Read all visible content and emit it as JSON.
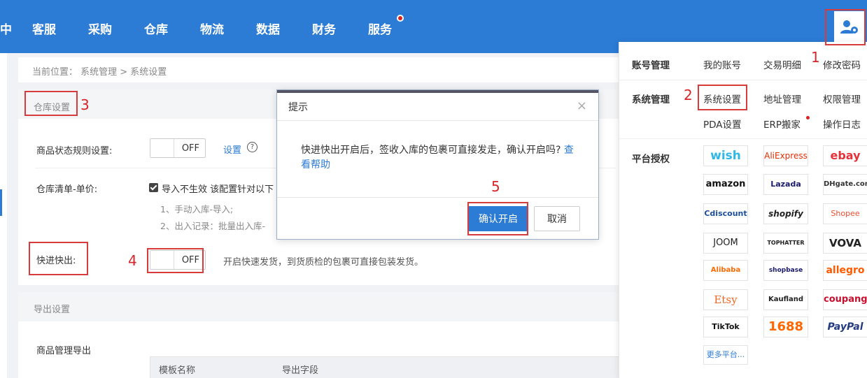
{
  "nav": {
    "items": [
      "客服",
      "采购",
      "仓库",
      "物流",
      "数据",
      "财务",
      "服务"
    ]
  },
  "breadcrumb": "当前位置：  系统管理 > 系统设置",
  "warehouse": {
    "title": "仓库设置",
    "status_rule_label": "商品状态规则设置:",
    "status_rule_toggle": "OFF",
    "status_rule_link": "设置",
    "help_icon": "?",
    "price_label": "仓库清单-单价:",
    "price_check_text": "导入不生效 该配置针对以下",
    "price_line1": "1、手动入库-导入;",
    "price_line2": "2、出入记录：批量出入库-",
    "fast_label": "快进快出:",
    "fast_toggle": "OFF",
    "fast_desc": "开启快速发货，到货质检的包裹可直接包装发货。"
  },
  "export": {
    "title": "导出设置",
    "product_export": "商品管理导出",
    "col1": "模板名称",
    "col2": "导出字段"
  },
  "dialog": {
    "title": "提示",
    "close": "×",
    "message": "快进快出开启后，签收入库的包裹可直接发走，确认开启吗?",
    "help_link": "查看帮助",
    "confirm": "确认开启",
    "cancel": "取消"
  },
  "dropdown": {
    "account_group": "账号管理",
    "account_items": [
      "我的账号",
      "交易明细",
      "修改密码"
    ],
    "system_group": "系统管理",
    "system_items": [
      "系统设置",
      "地址管理",
      "权限管理",
      "PDA设置",
      "ERP搬家",
      "操作日志"
    ],
    "platform_group": "平台授权",
    "platforms": [
      "wish",
      "AliExpress",
      "ebay",
      "amazon",
      "Lazada",
      "DHgate.com",
      "Cdiscount",
      "shopify",
      "Shopee",
      "JOOM",
      "TOPHATTER",
      "VOVA",
      "Alibaba",
      "shopbase",
      "allegro",
      "Etsy",
      "Kaufland",
      "coupang",
      "TikTok",
      "1688",
      "PayPal"
    ],
    "more": "更多平台..."
  },
  "annotations": [
    "1",
    "2",
    "3",
    "4",
    "5"
  ],
  "colors": {
    "nav_bg": "#2c7bd4",
    "primary": "#2c7bd4",
    "annotation_red": "#d83b3b"
  }
}
